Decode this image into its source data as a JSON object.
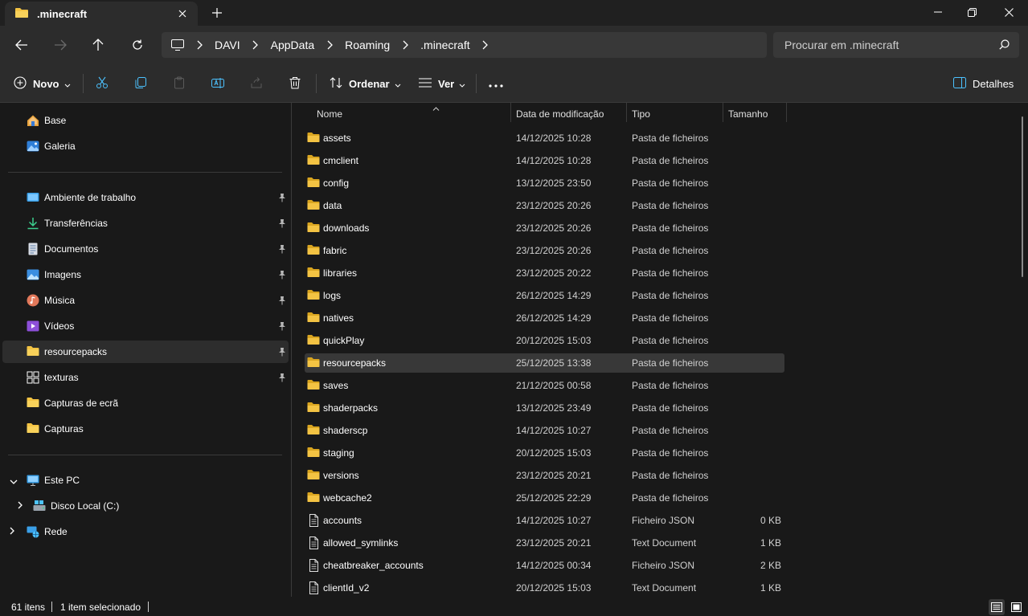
{
  "window": {
    "tab_title": ".minecraft"
  },
  "nav": {
    "breadcrumb": [
      "DAVI",
      "AppData",
      "Roaming",
      ".minecraft"
    ],
    "search_placeholder": "Procurar em .minecraft"
  },
  "toolbar": {
    "new_label": "Novo",
    "sort_label": "Ordenar",
    "view_label": "Ver",
    "details_label": "Detalhes"
  },
  "sidebar": {
    "top": [
      {
        "label": "Base",
        "icon": "home-icon"
      },
      {
        "label": "Galeria",
        "icon": "gallery-icon"
      }
    ],
    "quick": [
      {
        "label": "Ambiente de trabalho",
        "icon": "desktop-icon",
        "pinned": true
      },
      {
        "label": "Transferências",
        "icon": "download-icon",
        "pinned": true
      },
      {
        "label": "Documentos",
        "icon": "document-icon",
        "pinned": true
      },
      {
        "label": "Imagens",
        "icon": "pictures-icon",
        "pinned": true
      },
      {
        "label": "Música",
        "icon": "music-icon",
        "pinned": true
      },
      {
        "label": "Vídeos",
        "icon": "videos-icon",
        "pinned": true
      },
      {
        "label": "resourcepacks",
        "icon": "folder-icon",
        "pinned": true,
        "selected": true
      },
      {
        "label": "texturas",
        "icon": "grid-icon",
        "pinned": true
      },
      {
        "label": "Capturas de ecrã",
        "icon": "folder-icon",
        "pinned": false
      },
      {
        "label": "Capturas",
        "icon": "folder-icon",
        "pinned": false
      }
    ],
    "tree": [
      {
        "label": "Este PC",
        "icon": "pc-icon"
      },
      {
        "label": "Disco Local (C:)",
        "icon": "drive-icon"
      },
      {
        "label": "Rede",
        "icon": "network-icon"
      }
    ]
  },
  "columns": {
    "name": "Nome",
    "date": "Data de modificação",
    "type": "Tipo",
    "size": "Tamanho"
  },
  "files": [
    {
      "name": "assets",
      "date": "14/12/2025 10:28",
      "type": "Pasta de ficheiros",
      "size": "",
      "kind": "folder"
    },
    {
      "name": "cmclient",
      "date": "14/12/2025 10:28",
      "type": "Pasta de ficheiros",
      "size": "",
      "kind": "folder"
    },
    {
      "name": "config",
      "date": "13/12/2025 23:50",
      "type": "Pasta de ficheiros",
      "size": "",
      "kind": "folder"
    },
    {
      "name": "data",
      "date": "23/12/2025 20:26",
      "type": "Pasta de ficheiros",
      "size": "",
      "kind": "folder"
    },
    {
      "name": "downloads",
      "date": "23/12/2025 20:26",
      "type": "Pasta de ficheiros",
      "size": "",
      "kind": "folder"
    },
    {
      "name": "fabric",
      "date": "23/12/2025 20:26",
      "type": "Pasta de ficheiros",
      "size": "",
      "kind": "folder"
    },
    {
      "name": "libraries",
      "date": "23/12/2025 20:22",
      "type": "Pasta de ficheiros",
      "size": "",
      "kind": "folder"
    },
    {
      "name": "logs",
      "date": "26/12/2025 14:29",
      "type": "Pasta de ficheiros",
      "size": "",
      "kind": "folder"
    },
    {
      "name": "natives",
      "date": "26/12/2025 14:29",
      "type": "Pasta de ficheiros",
      "size": "",
      "kind": "folder"
    },
    {
      "name": "quickPlay",
      "date": "20/12/2025 15:03",
      "type": "Pasta de ficheiros",
      "size": "",
      "kind": "folder"
    },
    {
      "name": "resourcepacks",
      "date": "25/12/2025 13:38",
      "type": "Pasta de ficheiros",
      "size": "",
      "kind": "folder",
      "selected": true
    },
    {
      "name": "saves",
      "date": "21/12/2025 00:58",
      "type": "Pasta de ficheiros",
      "size": "",
      "kind": "folder"
    },
    {
      "name": "shaderpacks",
      "date": "13/12/2025 23:49",
      "type": "Pasta de ficheiros",
      "size": "",
      "kind": "folder"
    },
    {
      "name": "shaderscp",
      "date": "14/12/2025 10:27",
      "type": "Pasta de ficheiros",
      "size": "",
      "kind": "folder"
    },
    {
      "name": "staging",
      "date": "20/12/2025 15:03",
      "type": "Pasta de ficheiros",
      "size": "",
      "kind": "folder"
    },
    {
      "name": "versions",
      "date": "23/12/2025 20:21",
      "type": "Pasta de ficheiros",
      "size": "",
      "kind": "folder"
    },
    {
      "name": "webcache2",
      "date": "25/12/2025 22:29",
      "type": "Pasta de ficheiros",
      "size": "",
      "kind": "folder"
    },
    {
      "name": "accounts",
      "date": "14/12/2025 10:27",
      "type": "Ficheiro JSON",
      "size": "0 KB",
      "kind": "file"
    },
    {
      "name": "allowed_symlinks",
      "date": "23/12/2025 20:21",
      "type": "Text Document",
      "size": "1 KB",
      "kind": "file"
    },
    {
      "name": "cheatbreaker_accounts",
      "date": "14/12/2025 00:34",
      "type": "Ficheiro JSON",
      "size": "2 KB",
      "kind": "file"
    },
    {
      "name": "clientId_v2",
      "date": "20/12/2025 15:03",
      "type": "Text Document",
      "size": "1 KB",
      "kind": "file"
    }
  ],
  "status": {
    "count": "61 itens",
    "selection": "1 item selecionado"
  },
  "colors": {
    "folder": "#f3c343",
    "folder_dark": "#d9a520",
    "accent": "#4cc2ff"
  }
}
